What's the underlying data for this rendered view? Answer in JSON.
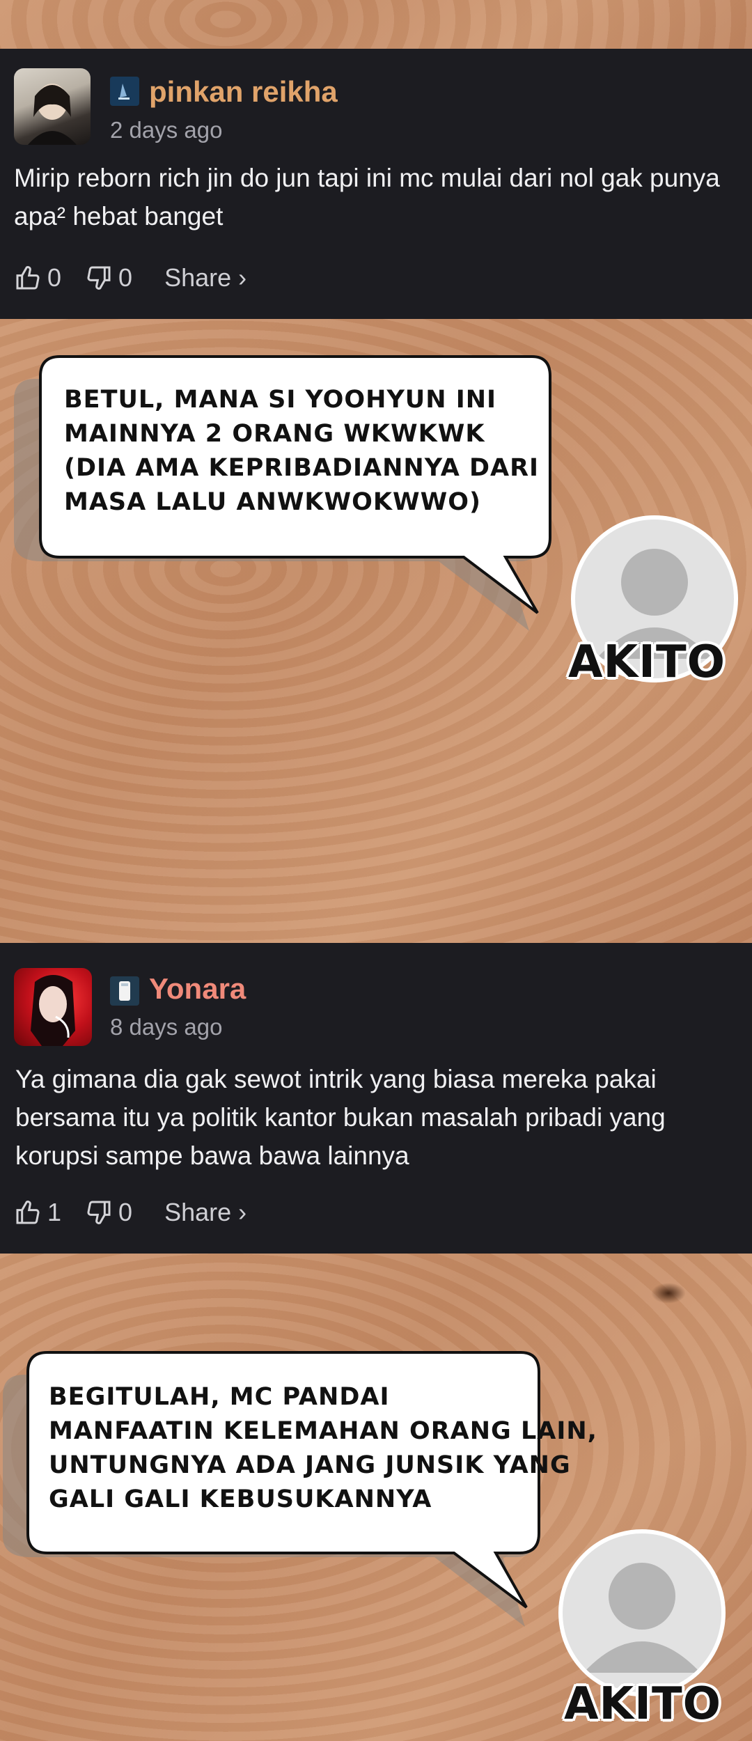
{
  "comments": [
    {
      "username": "pinkan reikha",
      "time": "2 days ago",
      "text": "Mirip reborn rich jin do jun tapi ini mc mulai dari nol gak punya apa² hebat banget",
      "likes": "0",
      "dislikes": "0",
      "share_label": "Share ›",
      "name_color": "#e0a36a"
    },
    {
      "username": "Yonara",
      "time": "8 days ago",
      "text": "Ya gimana dia gak sewot intrik yang biasa mereka pakai bersama itu ya politik kantor bukan masalah pribadi yang korupsi sampe bawa bawa lainnya",
      "likes": "1",
      "dislikes": "0",
      "share_label": "Share ›",
      "name_color": "#f08a7a"
    }
  ],
  "replies": [
    {
      "text_lines": [
        "BETUL, MANA SI YOOHYUN INI",
        "MAINNYA 2 ORANG WKWKWK",
        "(DIA AMA KEPRIBADIANNYA DARI",
        "MASA LALU ANWKWOKWWO)"
      ],
      "author": "AKITO"
    },
    {
      "text_lines": [
        "BEGITULAH, MC PANDAI",
        "MANFAATIN KELEMAHAN ORANG LAIN,",
        "UNTUNGNYA ADA JANG JUNSIK YANG",
        "GALI GALI KEBUSUKANNYA"
      ],
      "author": "AKITO"
    }
  ]
}
